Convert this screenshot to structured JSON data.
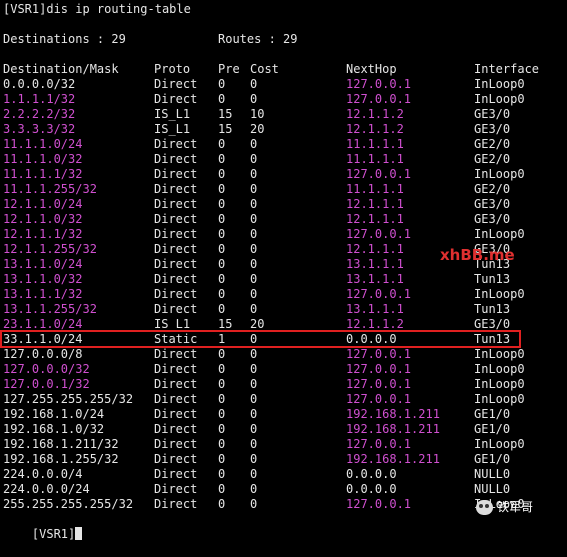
{
  "terminal": {
    "prompt_line": "[VSR1]dis ip routing-table",
    "summary": {
      "destinations": "Destinations : 29",
      "routes": "Routes : 29"
    },
    "headers": [
      "Destination/Mask",
      "Proto",
      "Pre",
      "Cost",
      "NextHop",
      "Interface"
    ],
    "rows": [
      [
        "0.0.0.0/32",
        "Direct",
        "0",
        "0",
        "127.0.0.1",
        "InLoop0"
      ],
      [
        "1.1.1.1/32",
        "Direct",
        "0",
        "0",
        "127.0.0.1",
        "InLoop0"
      ],
      [
        "2.2.2.2/32",
        "IS_L1",
        "15",
        "10",
        "12.1.1.2",
        "GE3/0"
      ],
      [
        "3.3.3.3/32",
        "IS_L1",
        "15",
        "20",
        "12.1.1.2",
        "GE3/0"
      ],
      [
        "11.1.1.0/24",
        "Direct",
        "0",
        "0",
        "11.1.1.1",
        "GE2/0"
      ],
      [
        "11.1.1.0/32",
        "Direct",
        "0",
        "0",
        "11.1.1.1",
        "GE2/0"
      ],
      [
        "11.1.1.1/32",
        "Direct",
        "0",
        "0",
        "127.0.0.1",
        "InLoop0"
      ],
      [
        "11.1.1.255/32",
        "Direct",
        "0",
        "0",
        "11.1.1.1",
        "GE2/0"
      ],
      [
        "12.1.1.0/24",
        "Direct",
        "0",
        "0",
        "12.1.1.1",
        "GE3/0"
      ],
      [
        "12.1.1.0/32",
        "Direct",
        "0",
        "0",
        "12.1.1.1",
        "GE3/0"
      ],
      [
        "12.1.1.1/32",
        "Direct",
        "0",
        "0",
        "127.0.0.1",
        "InLoop0"
      ],
      [
        "12.1.1.255/32",
        "Direct",
        "0",
        "0",
        "12.1.1.1",
        "GE3/0"
      ],
      [
        "13.1.1.0/24",
        "Direct",
        "0",
        "0",
        "13.1.1.1",
        "Tun13"
      ],
      [
        "13.1.1.0/32",
        "Direct",
        "0",
        "0",
        "13.1.1.1",
        "Tun13"
      ],
      [
        "13.1.1.1/32",
        "Direct",
        "0",
        "0",
        "127.0.0.1",
        "InLoop0"
      ],
      [
        "13.1.1.255/32",
        "Direct",
        "0",
        "0",
        "13.1.1.1",
        "Tun13"
      ],
      [
        "23.1.1.0/24",
        "IS_L1",
        "15",
        "20",
        "12.1.1.2",
        "GE3/0"
      ],
      [
        "33.1.1.0/24",
        "Static",
        "1",
        "0",
        "0.0.0.0",
        "Tun13"
      ],
      [
        "127.0.0.0/8",
        "Direct",
        "0",
        "0",
        "127.0.0.1",
        "InLoop0"
      ],
      [
        "127.0.0.0/32",
        "Direct",
        "0",
        "0",
        "127.0.0.1",
        "InLoop0"
      ],
      [
        "127.0.0.1/32",
        "Direct",
        "0",
        "0",
        "127.0.0.1",
        "InLoop0"
      ],
      [
        "127.255.255.255/32",
        "Direct",
        "0",
        "0",
        "127.0.0.1",
        "InLoop0"
      ],
      [
        "192.168.1.0/24",
        "Direct",
        "0",
        "0",
        "192.168.1.211",
        "GE1/0"
      ],
      [
        "192.168.1.0/32",
        "Direct",
        "0",
        "0",
        "192.168.1.211",
        "GE1/0"
      ],
      [
        "192.168.1.211/32",
        "Direct",
        "0",
        "0",
        "127.0.0.1",
        "InLoop0"
      ],
      [
        "192.168.1.255/32",
        "Direct",
        "0",
        "0",
        "192.168.1.211",
        "GE1/0"
      ],
      [
        "224.0.0.0/4",
        "Direct",
        "0",
        "0",
        "0.0.0.0",
        "NULL0"
      ],
      [
        "224.0.0.0/24",
        "Direct",
        "0",
        "0",
        "0.0.0.0",
        "NULL0"
      ],
      [
        "255.255.255.255/32",
        "Direct",
        "0",
        "0",
        "127.0.0.1",
        "InLoop0"
      ]
    ],
    "white_destination_rows": [
      0,
      17,
      18,
      21,
      22,
      23,
      24,
      25,
      26,
      27,
      28
    ],
    "white_nexthop_rows": [
      17,
      26,
      27
    ],
    "highlighted_row": 17,
    "final_prompt": "[VSR1]"
  },
  "colors": {
    "background": "#000000",
    "text": "#e6e6e6",
    "magenta": "#d050d0",
    "highlight": "#e02020"
  },
  "overlays": {
    "watermark": "xhBB.me",
    "logo_text": "铁军哥",
    "logo_icon": "wechat-icon"
  }
}
